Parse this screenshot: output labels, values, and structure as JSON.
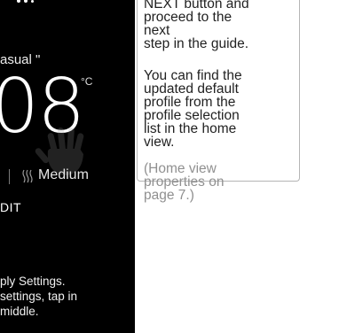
{
  "device": {
    "profile_name": "asual \"",
    "temperature": "08",
    "unit": "°C",
    "mode_label": "Medium",
    "mode_icon": "heat-waves-icon",
    "edit_label": "DIT",
    "instructions": [
      "ply Settings.",
      " settings, tap in",
      "middle."
    ],
    "background_color": "#000000",
    "text_color": "#ffffff"
  },
  "guide": {
    "callout_lines": [
      "NEXT button and",
      "proceed to the",
      "next",
      "step in the guide.",
      "",
      "You can find the",
      "updated default",
      "profile from the",
      "profile selection",
      "list in the home"
    ],
    "after_line": "view.",
    "reference_lines": [
      "(Home view",
      "properties on",
      "page 7.)"
    ]
  }
}
